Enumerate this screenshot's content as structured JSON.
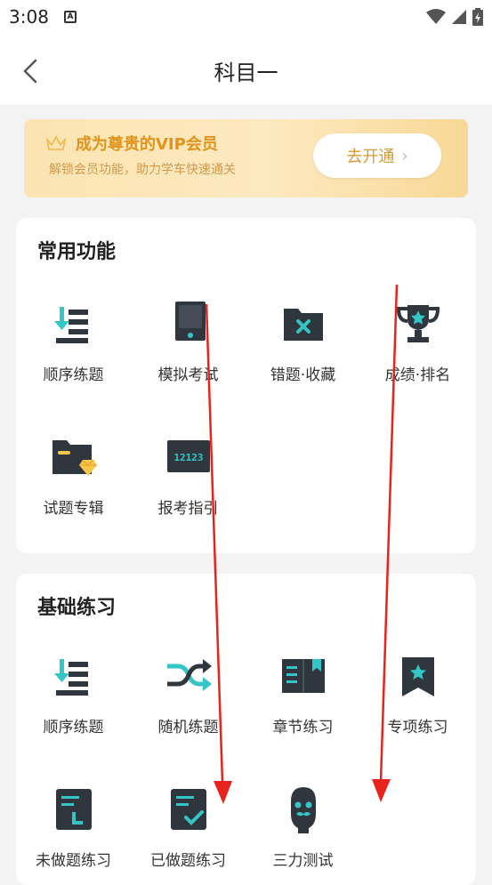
{
  "status": {
    "time": "3:08",
    "app_badge": "A"
  },
  "header": {
    "title": "科目一"
  },
  "vip": {
    "title": "成为尊贵的VIP会员",
    "subtitle": "解锁会员功能，助力学车快速通关",
    "button": "去开通"
  },
  "common": {
    "title": "常用功能",
    "items": [
      {
        "label": "顺序练题",
        "icon": "sequential-practice-icon"
      },
      {
        "label": "模拟考试",
        "icon": "mock-exam-icon"
      },
      {
        "label": "错题·收藏",
        "icon": "wrong-questions-folder-icon"
      },
      {
        "label": "成绩·排名",
        "icon": "trophy-icon"
      },
      {
        "label": "试题专辑",
        "icon": "question-album-icon"
      },
      {
        "label": "报考指引",
        "icon": "12123-icon"
      }
    ]
  },
  "basic": {
    "title": "基础练习",
    "items": [
      {
        "label": "顺序练题",
        "icon": "sequential-practice-icon"
      },
      {
        "label": "随机练题",
        "icon": "shuffle-icon"
      },
      {
        "label": "章节练习",
        "icon": "chapter-book-icon"
      },
      {
        "label": "专项练习",
        "icon": "special-bookmark-icon"
      },
      {
        "label": "未做题练习",
        "icon": "undone-questions-icon"
      },
      {
        "label": "已做题练习",
        "icon": "done-questions-icon"
      },
      {
        "label": "三力测试",
        "icon": "three-ability-test-icon"
      }
    ],
    "badge_text": "12123"
  },
  "colors": {
    "accent": "#34c6c6",
    "dark_icon": "#30363d",
    "annotation_red": "#e8231d"
  }
}
